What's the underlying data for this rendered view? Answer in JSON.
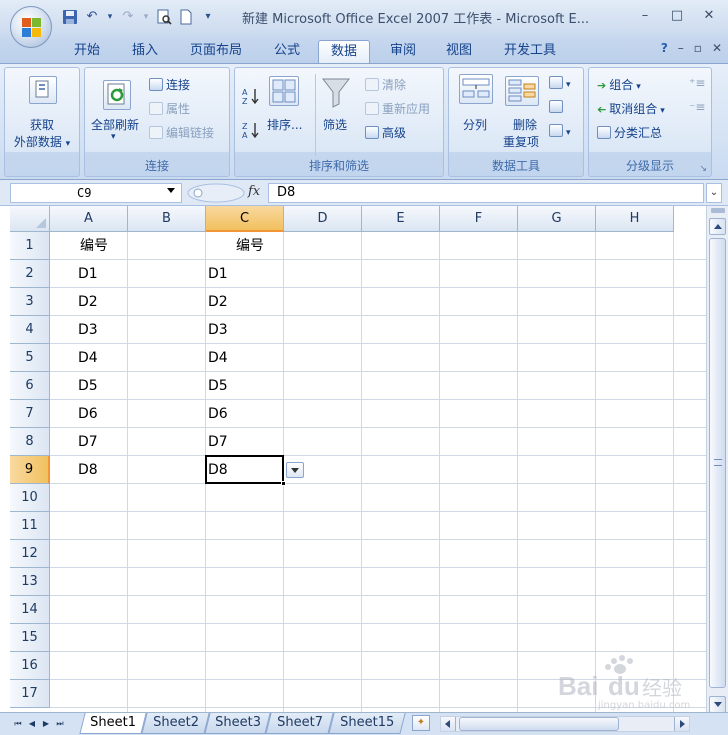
{
  "window": {
    "title": "新建 Microsoft Office Excel 2007 工作表 - Microsoft E...",
    "controls": [
      "–",
      "□",
      "✕"
    ]
  },
  "tabs": [
    "开始",
    "插入",
    "页面布局",
    "公式",
    "数据",
    "审阅",
    "视图",
    "开发工具"
  ],
  "active_tab": "数据",
  "ribbon": {
    "get_external": {
      "line1": "获取",
      "line2": "外部数据",
      "arrow": "▾"
    },
    "connections": {
      "refresh_all": "全部刷新",
      "connections": "连接",
      "properties": "属性",
      "edit_links": "编辑链接",
      "label": "连接"
    },
    "sort_filter": {
      "sort": "排序...",
      "filter": "筛选",
      "clear": "清除",
      "reapply": "重新应用",
      "advanced": "高级",
      "label": "排序和筛选"
    },
    "data_tools": {
      "text_to_columns": "分列",
      "remove_dup_1": "删除",
      "remove_dup_2": "重复项",
      "label": "数据工具"
    },
    "outline": {
      "group": "组合",
      "ungroup": "取消组合",
      "subtotal": "分类汇总",
      "label": "分级显示"
    }
  },
  "formula_bar": {
    "name_box": "C9",
    "fx": "fx",
    "content": "D8"
  },
  "grid": {
    "columns": [
      "A",
      "B",
      "C",
      "D",
      "E",
      "F",
      "G",
      "H"
    ],
    "selected_column": "C",
    "rows": [
      "1",
      "2",
      "3",
      "4",
      "5",
      "6",
      "7",
      "8",
      "9",
      "10",
      "11",
      "12",
      "13",
      "14",
      "15",
      "16",
      "17"
    ],
    "selected_row": "9",
    "col_a": [
      "编号",
      "D1",
      "D2",
      "D3",
      "D4",
      "D5",
      "D6",
      "D7",
      "D8"
    ],
    "col_c": [
      "编号",
      "D1",
      "D2",
      "D3",
      "D4",
      "D5",
      "D6",
      "D7",
      "D8"
    ],
    "active_cell": "C9"
  },
  "sheets": [
    "Sheet1",
    "Sheet2",
    "Sheet3",
    "Sheet7",
    "Sheet15"
  ],
  "active_sheet": "Sheet1",
  "watermark": {
    "text": "Baidu经验",
    "sub": "jingyan.baidu.com"
  },
  "colors": {
    "ribbon_blue": "#15428b",
    "selected_header": "#f9d99f",
    "selected_header_border": "#f29536",
    "gridline": "#d0d7e5"
  }
}
